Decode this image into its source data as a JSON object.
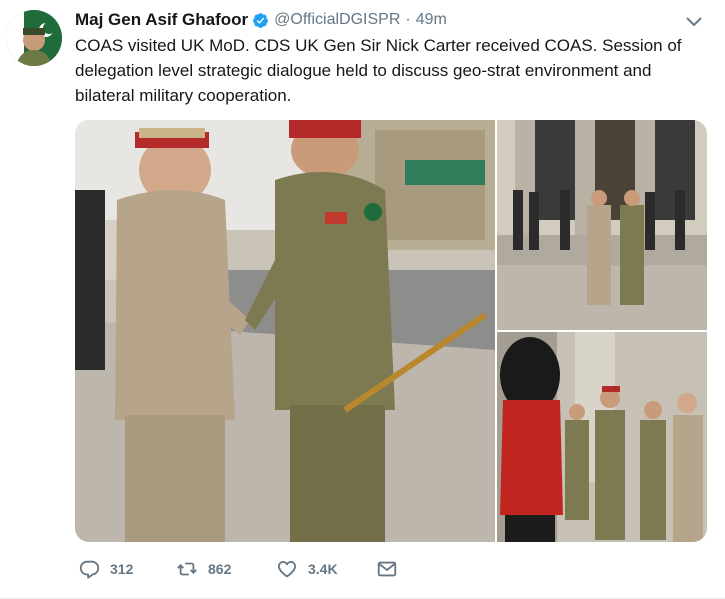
{
  "tweet": {
    "author_name": "Maj Gen Asif Ghafoor",
    "handle": "@OfficialDGISPR",
    "separator": "·",
    "time": "49m",
    "text": "COAS visited UK MoD. CDS UK Gen Sir Nick Carter received COAS. Session of delegation level strategic dialogue held to discuss geo-strat environment and bilateral military cooperation.",
    "verified_icon": "verified-badge-icon",
    "menu_icon": "chevron-down-icon"
  },
  "actions": {
    "reply_count": "312",
    "retweet_count": "862",
    "like_count": "3.4K",
    "message_icon": "envelope-icon"
  },
  "colors": {
    "verified_blue": "#1da1f2",
    "meta_gray": "#657786",
    "text": "#14171a"
  }
}
